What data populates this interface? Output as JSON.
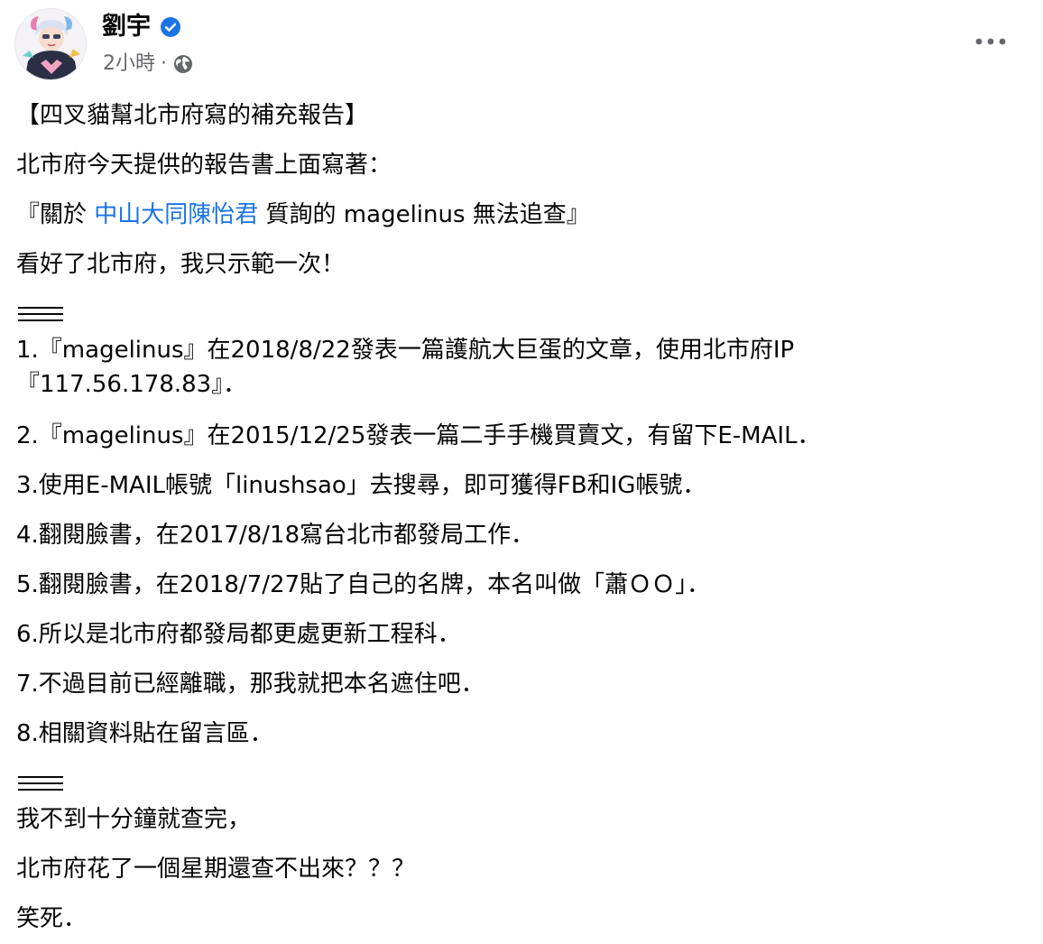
{
  "author": {
    "name": "劉宇",
    "verified": true
  },
  "timestamp": "2小時",
  "meta_separator": "·",
  "audience_icon": "globe-icon",
  "more_icon": "more-options-icon",
  "colors": {
    "mention": "#1b74e4",
    "verified": "#1b74e4",
    "meta": "#65676b",
    "text": "#050505"
  },
  "post": {
    "line1": "【四叉貓幫北市府寫的補充報告】",
    "line2": "北市府今天提供的報告書上面寫著：",
    "line3_pre": "『關於 ",
    "line3_mention": "中山大同陳怡君",
    "line3_post": " 質詢的 magelinus 無法追查』",
    "line4": "看好了北市府，我只示範一次！",
    "divider1": "===",
    "items": [
      "1.『magelinus』在2018/8/22發表一篇護航大巨蛋的文章，使用北市府IP",
      "『117.56.178.83』．",
      "2.『magelinus』在2015/12/25發表一篇二手手機買賣文，有留下E-MAIL．",
      "3.使用E-MAIL帳號「linushsao」去搜尋，即可獲得FB和IG帳號．",
      "4.翻閱臉書，在2017/8/18寫台北市都發局工作．",
      "5.翻閱臉書，在2018/7/27貼了自己的名牌，本名叫做「蕭ＯＯ」．",
      "6.所以是北市府都發局都更處更新工程科．",
      "7.不過目前已經離職，那我就把本名遮住吧．",
      "8.相關資料貼在留言區．"
    ],
    "divider2": "===",
    "closing": [
      "我不到十分鐘就查完，",
      "北市府花了一個星期還查不出來？？？",
      "笑死．"
    ]
  }
}
